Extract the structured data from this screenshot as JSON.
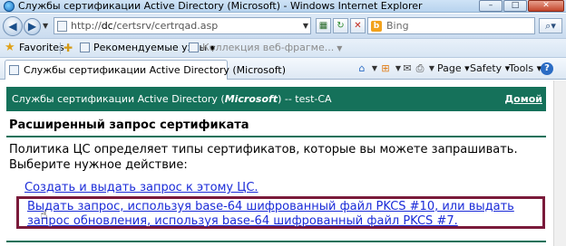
{
  "window": {
    "title": "Службы сертификации Active Directory (Microsoft) - Windows Internet Explorer",
    "minimize": "–",
    "maximize": "□",
    "close": "✕"
  },
  "nav": {
    "back_icon": "back-arrow-icon",
    "forward_icon": "forward-arrow-icon",
    "address_prefix": "http://",
    "address_host": "dc",
    "address_path": "/certsrv/certrqad.asp",
    "search_placeholder": "Bing",
    "bing_glyph": "b"
  },
  "favorites": {
    "label": "Favorites",
    "items": [
      {
        "label": "Рекомендуемые узлы",
        "dim": false
      },
      {
        "label": "Коллекция веб-фрагме...",
        "dim": true
      }
    ]
  },
  "tabs": [
    {
      "label": "Службы сертификации Active Directory (Microsoft)"
    }
  ],
  "commands": {
    "page": "Page",
    "safety": "Safety",
    "tools": "Tools"
  },
  "banner": {
    "title_pre": "Службы сертификации Active Directory (",
    "title_em": "Microsoft",
    "title_post": ")  --  test-CA",
    "home_link": "Домой"
  },
  "page": {
    "heading": "Расширенный запрос сертификата",
    "description": "Политика ЦС определяет типы сертификатов, которые вы можете запрашивать. Выберите нужное действие:",
    "link_create": "Создать и выдать запрос к этому ЦС.",
    "link_submit": "Выдать запрос, используя base-64 шифрованный файл PKCS #10, или выдать запрос обновления, используя base-64 шифрованный файл PKCS #7."
  },
  "colors": {
    "banner": "#15715a",
    "link": "#1a2bd8",
    "highlight_border": "#7a1a3a"
  }
}
